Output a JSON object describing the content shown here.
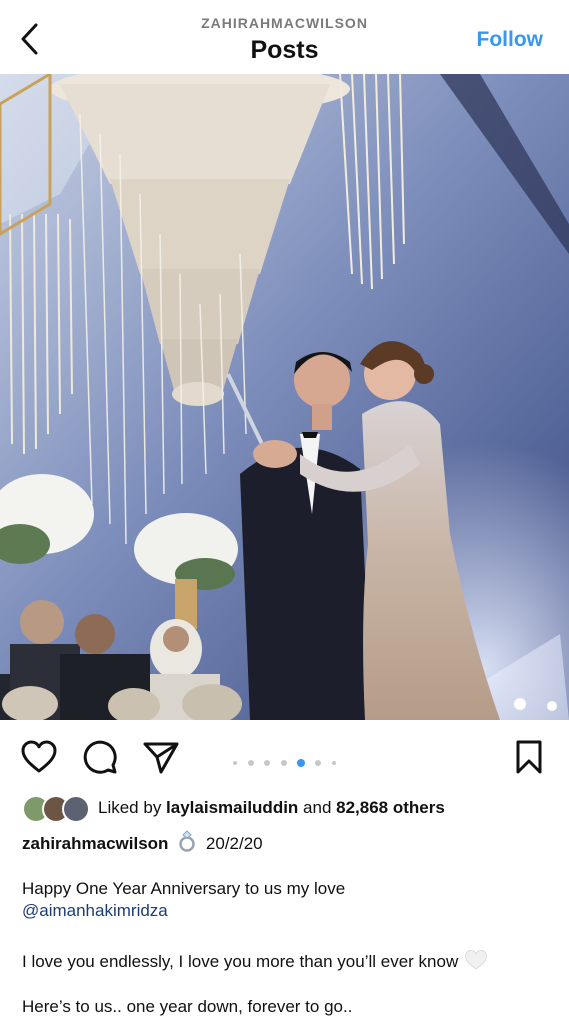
{
  "header": {
    "username": "ZAHIRAHMACWILSON",
    "title": "Posts",
    "follow_label": "Follow"
  },
  "post": {
    "carousel": {
      "count": 6,
      "active_index": 4
    },
    "likes": {
      "prefix": "Liked by ",
      "user": "laylaismailuddin",
      "middle": " and ",
      "count": "82,868 others"
    },
    "caption": {
      "username": "zahirahmacwilson",
      "date": "20/2/20",
      "line1": "Happy One Year Anniversary to us my love",
      "mention": "@aimanhakimridza",
      "line2": "I love you endlessly, I love you more than you’ll ever know",
      "line3": "Here’s to us.. one year down, forever to go.."
    }
  },
  "icons": {
    "back": "chevron-left-icon",
    "like": "heart-icon",
    "comment": "comment-bubble-icon",
    "share": "paper-plane-icon",
    "save": "bookmark-icon",
    "emoji_ring": "ring-emoji-icon",
    "emoji_heart": "white-heart-emoji-icon"
  },
  "colors": {
    "accent": "#3897f0",
    "mention": "#1c3c77",
    "muted": "#7a7a7a"
  }
}
